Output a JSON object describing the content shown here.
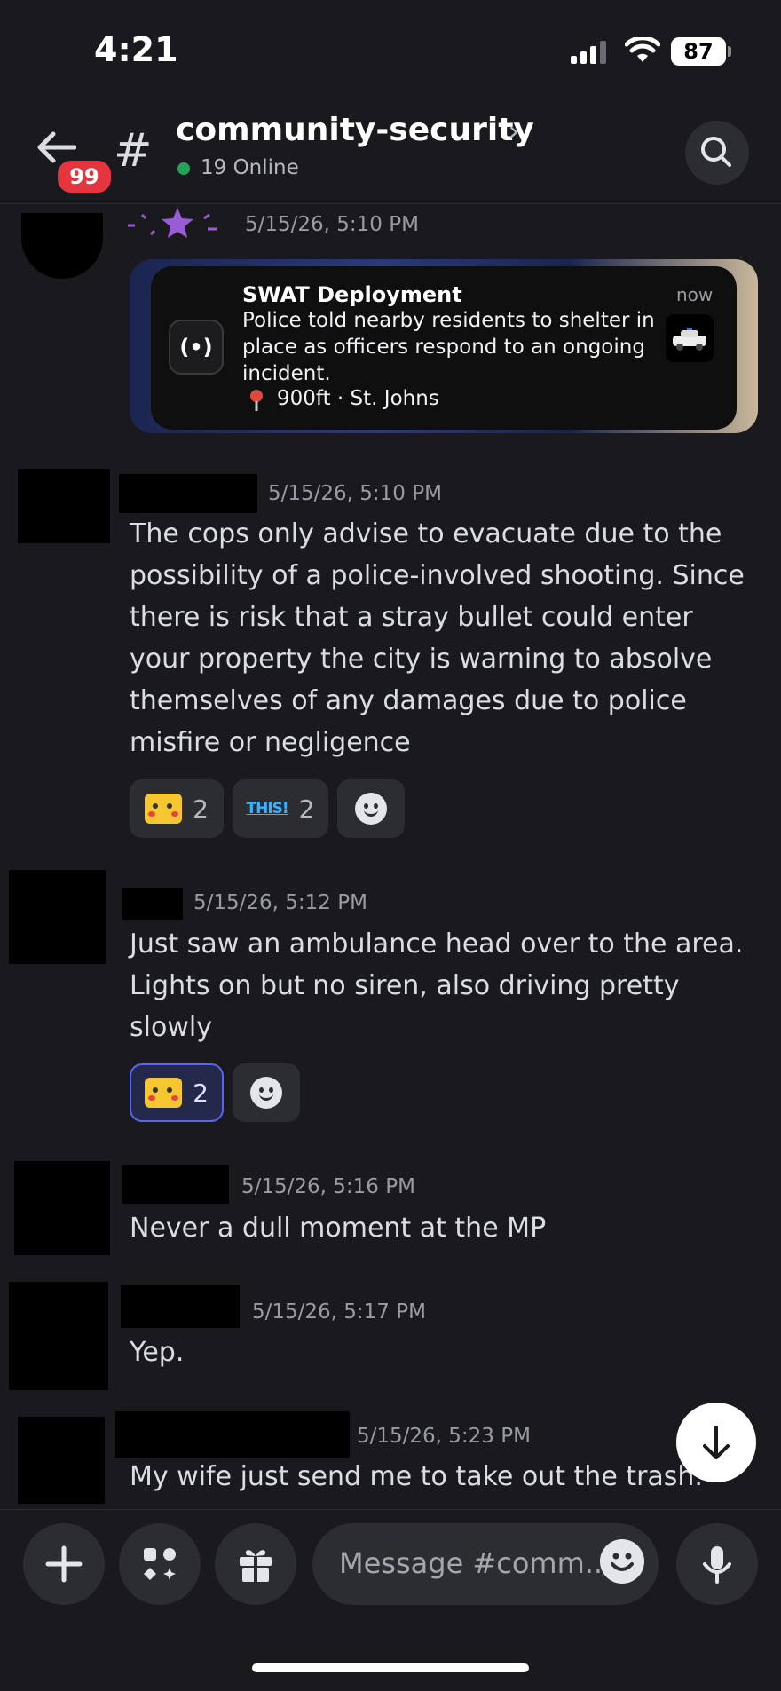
{
  "status_bar": {
    "time": "4:21",
    "battery": "87"
  },
  "header": {
    "unread_badge": "99",
    "channel_hash": "#",
    "channel_name": "community-security",
    "chevron": "›",
    "online_text": "19 Online"
  },
  "messages": [
    {
      "timestamp": "5/15/26, 5:10 PM",
      "embed": {
        "title": "SWAT Deployment",
        "time": "now",
        "body": "Police told nearby residents to shelter in place as officers respond to an ongoing incident.",
        "location": "900ft · St. Johns",
        "icon_text": "(•)"
      }
    },
    {
      "timestamp": "5/15/26, 5:10 PM",
      "lines": [
        "The cops only advise to evacuate due to the",
        "possibility of a police-involved shooting. Since",
        "there is risk that a stray bullet could enter",
        "your property the city is warning to absolve",
        "themselves of any damages due to police",
        "misfire or negligence"
      ],
      "reactions": [
        {
          "emoji": "surprised-pikachu",
          "count": "2"
        },
        {
          "emoji": "THIS!",
          "count": "2"
        }
      ]
    },
    {
      "timestamp": "5/15/26, 5:12 PM",
      "lines": [
        "Just saw an ambulance head over to the area.",
        "Lights on but no siren, also driving pretty",
        "slowly"
      ],
      "reactions": [
        {
          "emoji": "surprised-pikachu",
          "count": "2"
        }
      ]
    },
    {
      "timestamp": "5/15/26, 5:16 PM",
      "lines": [
        "Never a dull moment at the MP"
      ]
    },
    {
      "timestamp": "5/15/26, 5:17 PM",
      "lines": [
        "Yep."
      ]
    },
    {
      "timestamp": "5/15/26, 5:23 PM",
      "lines": [
        "My wife just send me to take out the trash."
      ]
    }
  ],
  "composer": {
    "placeholder": "Message #comm.."
  },
  "colors": {
    "background": "#1a1a1e",
    "online": "#23a559",
    "badge": "#e5363f",
    "accent": "#5865f2"
  }
}
